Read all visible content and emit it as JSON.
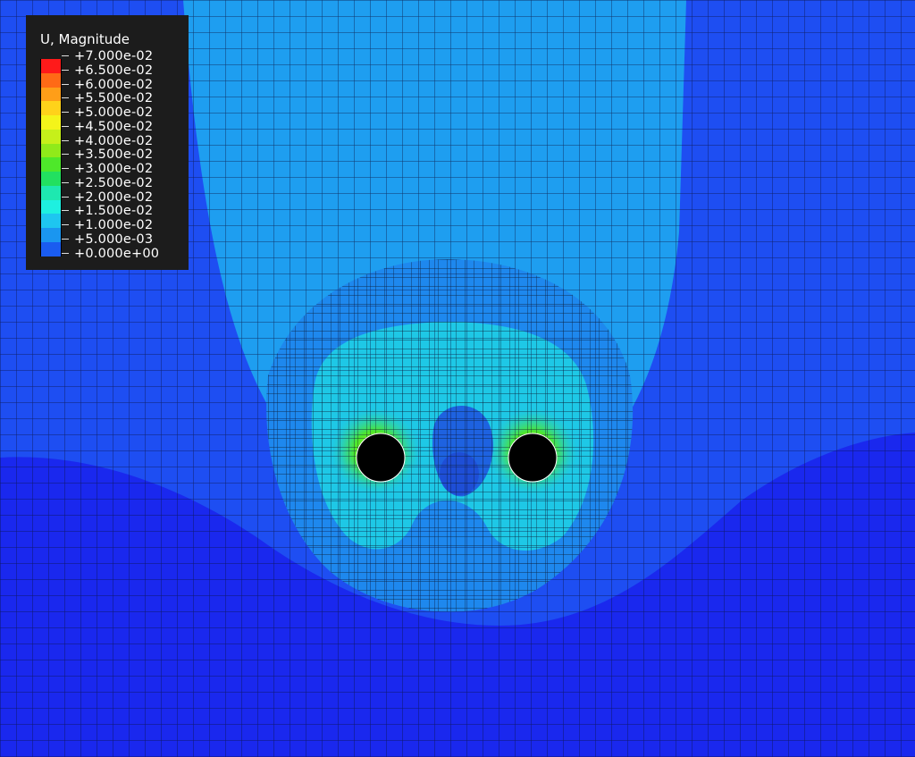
{
  "legend": {
    "title": "U, Magnitude",
    "labels": [
      "+7.000e-02",
      "+6.500e-02",
      "+6.000e-02",
      "+5.500e-02",
      "+5.000e-02",
      "+4.500e-02",
      "+4.000e-02",
      "+3.500e-02",
      "+3.000e-02",
      "+2.500e-02",
      "+2.000e-02",
      "+1.500e-02",
      "+1.000e-02",
      "+5.000e-03",
      "+0.000e+00"
    ],
    "colors": [
      "#ff1a1a",
      "#ff6a16",
      "#ff9e18",
      "#ffd21a",
      "#f4f41a",
      "#c6f01a",
      "#90ea1a",
      "#4ee82a",
      "#22e060",
      "#1ee8b0",
      "#1ef0e0",
      "#1ec6f0",
      "#1a96f0",
      "#1a5cf0",
      "#1a22e8"
    ]
  },
  "contour_colors": {
    "outer_field": "#1e4ef2",
    "lower_field": "#1a28ee",
    "upper_band": "#1ea0ee",
    "inner_region": "#1ec8e6",
    "hot_spot": "#9ae61e",
    "center_spot": "#1e62e0",
    "hole": "#000000"
  }
}
